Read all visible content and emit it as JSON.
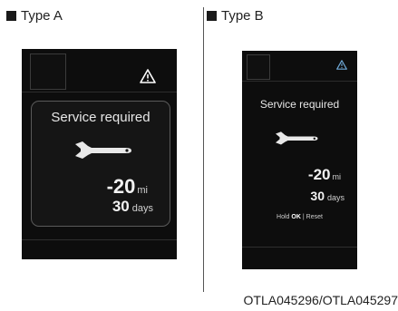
{
  "panels": {
    "a": {
      "type_label": "Type A",
      "title": "Service required",
      "distance_value": "-20",
      "distance_unit": "mi",
      "days_value": "30",
      "days_unit": "days"
    },
    "b": {
      "type_label": "Type B",
      "title": "Service required",
      "distance_value": "-20",
      "distance_unit": "mi",
      "days_value": "30",
      "days_unit": "days",
      "hold_text": "Hold",
      "ok_text": "OK",
      "separator": "|",
      "reset_text": "Reset"
    }
  },
  "caption": "OTLA045296/OTLA045297",
  "icons": {
    "warning": "warning-triangle-icon",
    "service": "wrench-icon",
    "marker": "black-square-icon"
  },
  "colors": {
    "screen_bg": "#0d0d0d",
    "warning_a": "#ffffff",
    "warning_b": "#6fa8d6"
  }
}
